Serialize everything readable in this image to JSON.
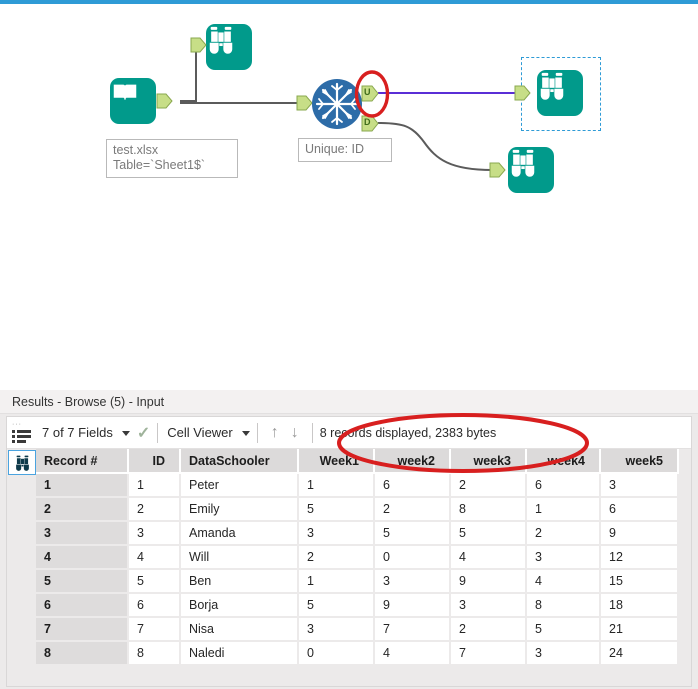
{
  "app": {
    "accent_color": "#2e9bd6",
    "tool_teal": "#019a8b",
    "annotation_color": "#d81f1f"
  },
  "canvas": {
    "nodes": [
      {
        "id": "input-tool",
        "icon": "book-icon",
        "label": "test.xlsx\nTable=`Sheet1$`",
        "output_anchors": [
          ""
        ]
      },
      {
        "id": "browse-top",
        "icon": "binoculars-icon",
        "label": "",
        "input_anchors": [
          ""
        ]
      },
      {
        "id": "unique-tool",
        "icon": "snowflake-icon",
        "label": "Unique: ID",
        "output_anchors": [
          "U",
          "D"
        ]
      },
      {
        "id": "browse-selected",
        "icon": "binoculars-icon",
        "label": "",
        "selected": true
      },
      {
        "id": "browse-bottom",
        "icon": "binoculars-icon",
        "label": ""
      }
    ],
    "anchor_labels": {
      "unique_out": "U",
      "dupe_out": "D"
    }
  },
  "results": {
    "title": "Results - Browse (5) - Input",
    "toolbar": {
      "grid_icon": "record-list-icon",
      "fields_label": "7 of 7 Fields",
      "fields_caret": "▾",
      "check_icon": "check-icon",
      "viewer_label": "Cell Viewer",
      "viewer_caret": "▾",
      "up_arrow": "↑",
      "down_arrow": "↓",
      "record_status": "8 records displayed, 2383 bytes"
    },
    "browse_tab_icon": "binoculars-icon",
    "table": {
      "columns": [
        "Record #",
        "ID",
        "DataSchooler",
        "Week1",
        "week2",
        "week3",
        "week4",
        "week5"
      ],
      "rows": [
        [
          "1",
          "1",
          "Peter",
          "1",
          "6",
          "2",
          "6",
          "3"
        ],
        [
          "2",
          "2",
          "Emily",
          "5",
          "2",
          "8",
          "1",
          "6"
        ],
        [
          "3",
          "3",
          "Amanda",
          "3",
          "5",
          "5",
          "2",
          "9"
        ],
        [
          "4",
          "4",
          "Will",
          "2",
          "0",
          "4",
          "3",
          "12"
        ],
        [
          "5",
          "5",
          "Ben",
          "1",
          "3",
          "9",
          "4",
          "15"
        ],
        [
          "6",
          "6",
          "Borja",
          "5",
          "9",
          "3",
          "8",
          "18"
        ],
        [
          "7",
          "7",
          "Nisa",
          "3",
          "7",
          "2",
          "5",
          "21"
        ],
        [
          "8",
          "8",
          "Naledi",
          "0",
          "4",
          "7",
          "3",
          "24"
        ]
      ]
    }
  }
}
